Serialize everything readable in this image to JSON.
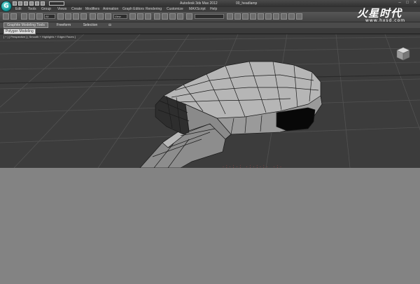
{
  "app": {
    "title": "Autodesk 3ds Max 2012",
    "file_name": "00_headlamp",
    "logo_letter": "G"
  },
  "window_controls": [
    "–",
    "□",
    "✕"
  ],
  "menu": {
    "items": [
      "Edit",
      "Tools",
      "Group",
      "Views",
      "Create",
      "Modifiers",
      "Animation",
      "Graph Editors",
      "Rendering",
      "Customize",
      "MAXScript",
      "Help"
    ]
  },
  "toolbar": {
    "selection_filter": "All",
    "view_dropdown": "View",
    "named_selection": ""
  },
  "ribbon": {
    "tabs": [
      "Graphite Modeling Tools",
      "Freeform",
      "Selection"
    ],
    "active_tab": 0,
    "panel_label": "Polygon Modeling"
  },
  "viewport": {
    "label": "[ + ] [ Perspective ] [ Smooth + Highlights + Edged Faces ]"
  },
  "watermark": {
    "logo": "火星时代",
    "url": "www.hxsd.com"
  },
  "fragments": {
    "scattered": "·:·:·: ·:·:·:·  ·:·"
  },
  "colors": {
    "viewport_bg": "#3c3c3c",
    "grid": "#555555",
    "mesh_top": "#b9b9b9",
    "mesh_side": "#8f8f8f",
    "mesh_dark": "#2a2a2a",
    "mesh_edge": "#1a1a1a",
    "lower_pane": "#838383"
  }
}
